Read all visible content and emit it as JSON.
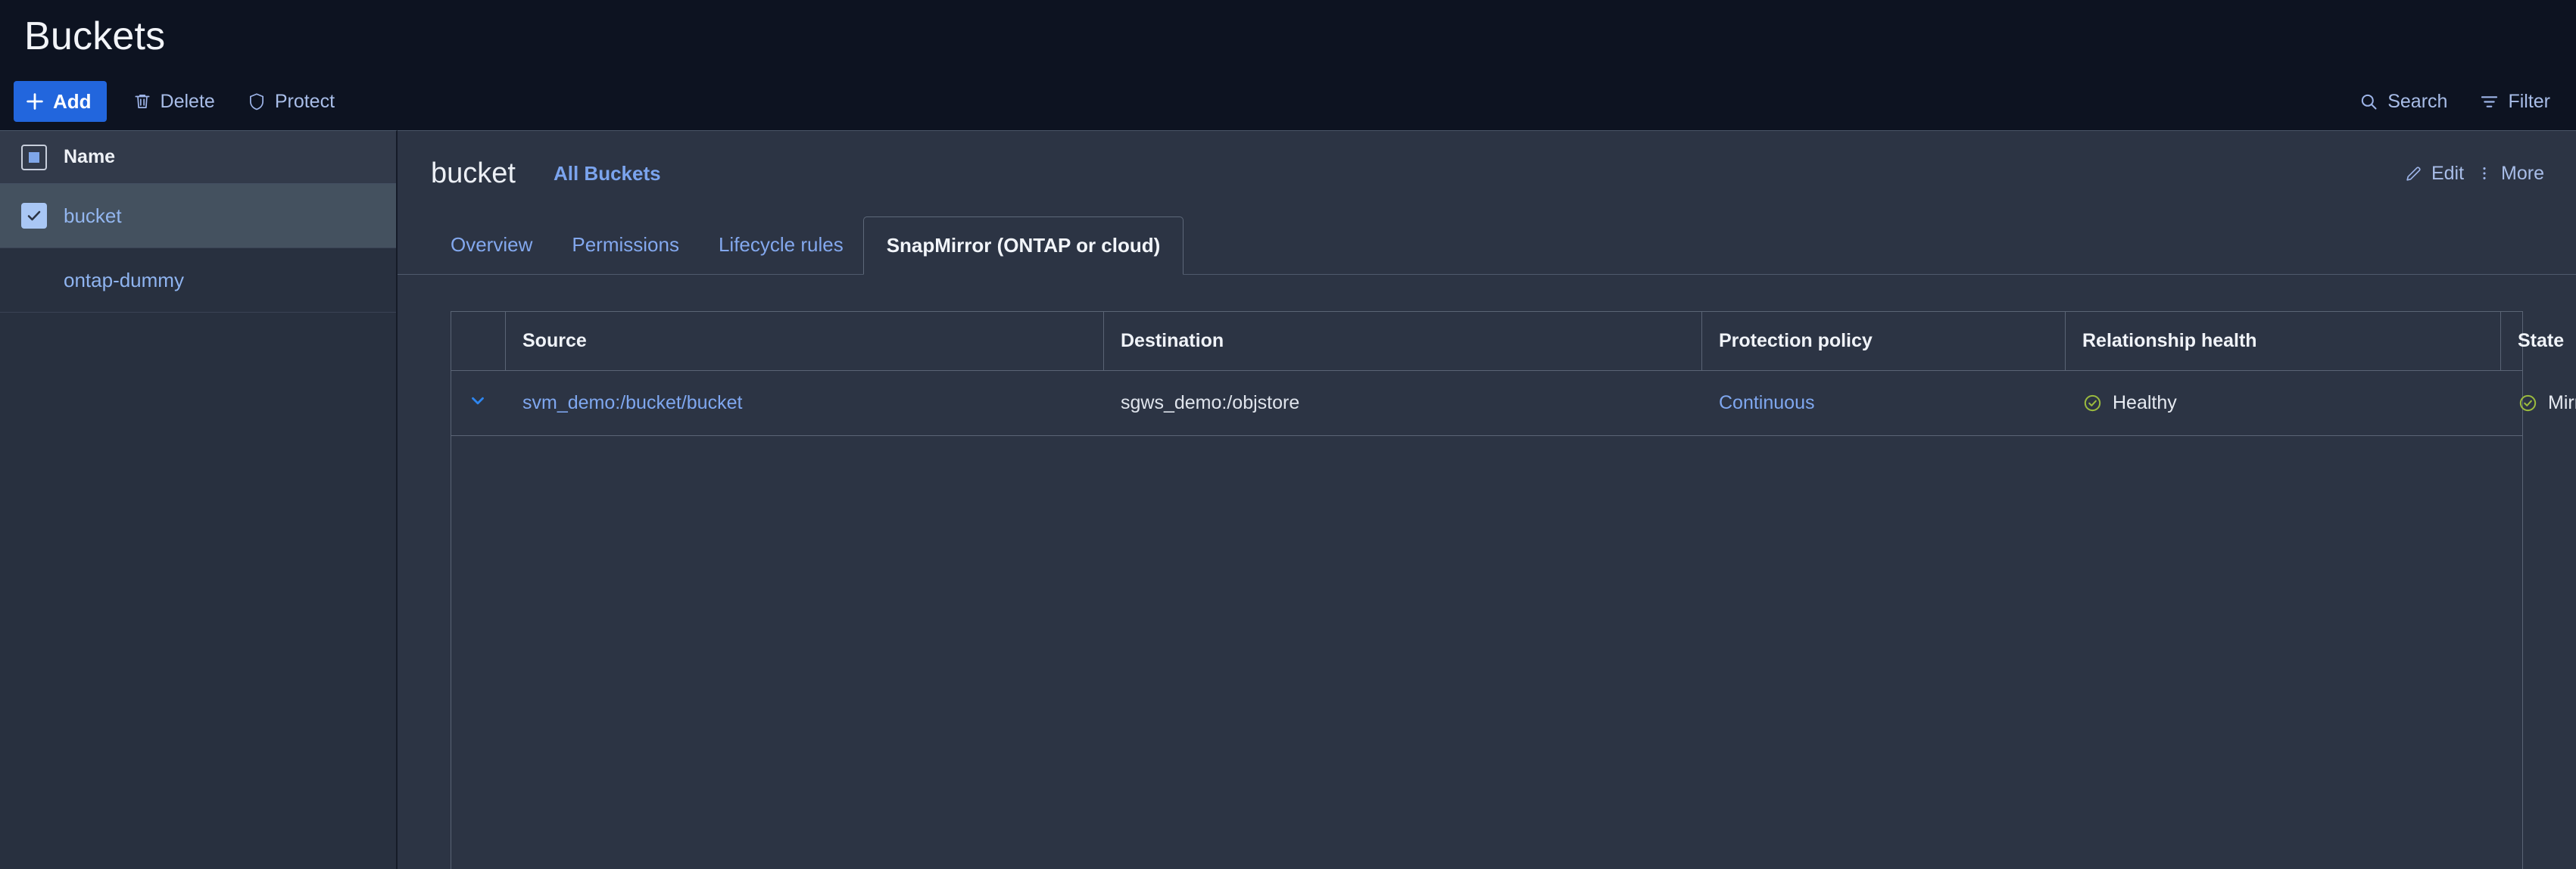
{
  "page": {
    "title": "Buckets"
  },
  "toolbar": {
    "add_label": "Add",
    "delete_label": "Delete",
    "protect_label": "Protect",
    "search_label": "Search",
    "filter_label": "Filter"
  },
  "list_pane": {
    "column_header": "Name",
    "header_checkbox_state": "indeterminate",
    "rows": [
      {
        "label": "bucket",
        "checked": true,
        "selected": true
      },
      {
        "label": "ontap-dummy",
        "checked": false,
        "selected": false
      }
    ]
  },
  "detail": {
    "object_title": "bucket",
    "breadcrumb_link": "All Buckets",
    "edit_label": "Edit",
    "more_label": "More",
    "tabs": [
      {
        "label": "Overview",
        "active": false
      },
      {
        "label": "Permissions",
        "active": false
      },
      {
        "label": "Lifecycle rules",
        "active": false
      },
      {
        "label": "SnapMirror (ONTAP or cloud)",
        "active": true
      }
    ],
    "table": {
      "columns": [
        "",
        "Source",
        "Destination",
        "Protection policy",
        "Relationship health",
        "State"
      ],
      "rows": [
        {
          "expander": "chevron-down",
          "source": "svm_demo:/bucket/bucket",
          "destination": "sgws_demo:/objstore",
          "protection_policy": "Continuous",
          "relationship_health": "Healthy",
          "state": "Mirrored"
        }
      ]
    }
  },
  "colors": {
    "accent_blue": "#2266dd",
    "link_blue": "#7fa7ef",
    "status_green": "#9bbb3e",
    "page_bg": "#0d1321",
    "panel_bg": "#2c3444",
    "list_bg": "#28303f",
    "selected_row": "#44515f"
  }
}
